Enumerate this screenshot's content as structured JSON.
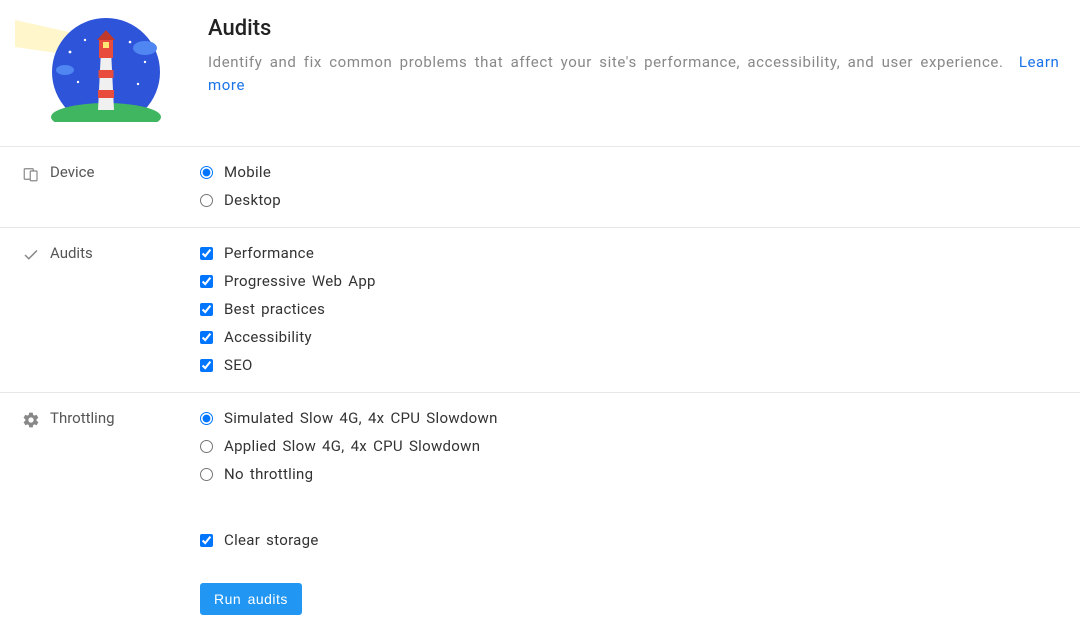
{
  "header": {
    "title": "Audits",
    "description": "Identify and fix common problems that affect your site's performance, accessibility, and user experience.",
    "learn_more": "Learn more"
  },
  "device": {
    "label": "Device",
    "options": [
      {
        "label": "Mobile",
        "selected": true
      },
      {
        "label": "Desktop",
        "selected": false
      }
    ]
  },
  "audits": {
    "label": "Audits",
    "options": [
      {
        "label": "Performance",
        "checked": true
      },
      {
        "label": "Progressive Web App",
        "checked": true
      },
      {
        "label": "Best practices",
        "checked": true
      },
      {
        "label": "Accessibility",
        "checked": true
      },
      {
        "label": "SEO",
        "checked": true
      }
    ]
  },
  "throttling": {
    "label": "Throttling",
    "options": [
      {
        "label": "Simulated Slow 4G, 4x CPU Slowdown",
        "selected": true
      },
      {
        "label": "Applied Slow 4G, 4x CPU Slowdown",
        "selected": false
      },
      {
        "label": "No throttling",
        "selected": false
      }
    ]
  },
  "storage": {
    "clear_label": "Clear storage",
    "clear_checked": true
  },
  "actions": {
    "run_label": "Run audits"
  }
}
